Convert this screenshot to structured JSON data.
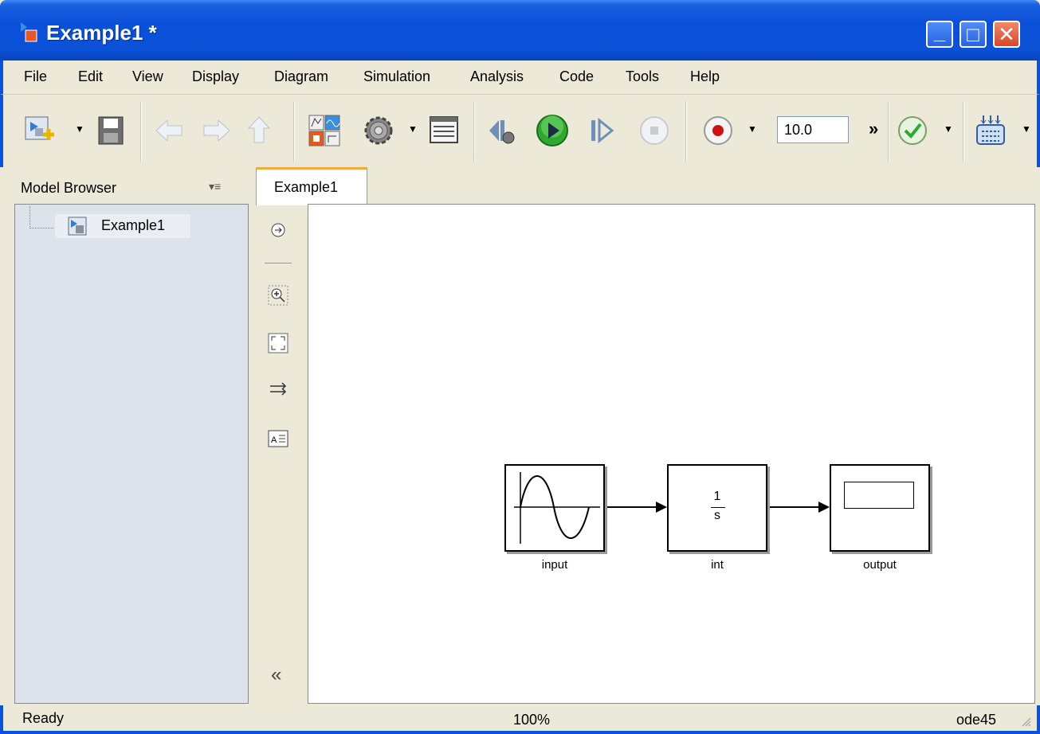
{
  "window": {
    "title": "Example1 *",
    "minimize_glyph": "_",
    "maximize_glyph": "□",
    "close_glyph": "✕"
  },
  "menu": {
    "items": [
      "File",
      "Edit",
      "View",
      "Display",
      "Diagram",
      "Simulation",
      "Analysis",
      "Code",
      "Tools",
      "Help"
    ]
  },
  "toolbar": {
    "stop_time": "10.0",
    "more": "»",
    "dropdown_glyph": "▼",
    "icons": [
      "new-model-icon",
      "save-icon",
      "back-icon",
      "forward-icon",
      "up-to-parent-icon",
      "library-browser-icon",
      "model-settings-icon",
      "model-explorer-icon",
      "step-back-icon",
      "run-icon",
      "step-forward-icon",
      "stop-icon",
      "record-icon",
      "model-advisor-icon",
      "build-icon"
    ]
  },
  "model_browser": {
    "title": "Model Browser",
    "menu_glyph": "▾≡",
    "tree": [
      {
        "label": "Example1"
      }
    ]
  },
  "editor": {
    "tab_label": "Example1",
    "collapse_glyph": "«",
    "blocks": [
      {
        "name": "input",
        "type": "sine-wave"
      },
      {
        "name": "int",
        "type": "integrator",
        "numerator": "1",
        "denominator": "s"
      },
      {
        "name": "output",
        "type": "scope"
      }
    ]
  },
  "status": {
    "state": "Ready",
    "zoom": "100%",
    "solver": "ode45"
  },
  "colors": {
    "titlebar": "#0b52d9",
    "chrome": "#ece9d8",
    "browser_panel": "#dde3ea",
    "tab_accent": "#f3a93c",
    "run_green": "#2fa82f",
    "record_red": "#cc1111"
  }
}
